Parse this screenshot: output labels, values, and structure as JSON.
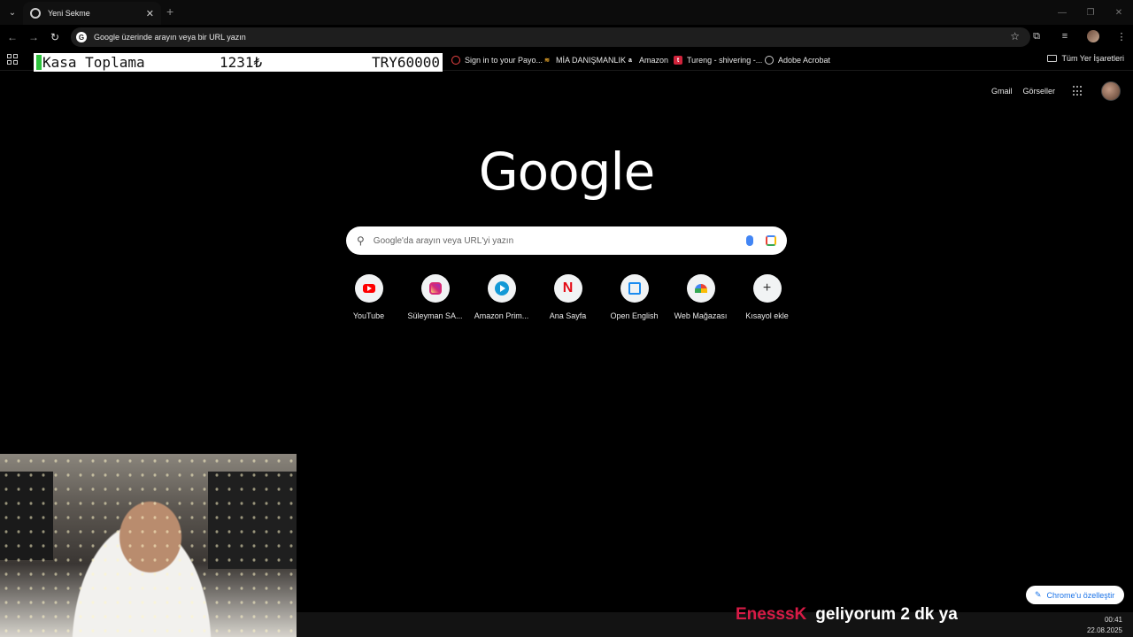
{
  "browser": {
    "tab": {
      "title": "Yeni Sekme"
    },
    "omnibox": {
      "text": "Google üzerinde arayın veya bir URL yazın"
    },
    "bookmarks": [
      {
        "label": "Sign in to your Payo...",
        "icon": "payoneer-icon"
      },
      {
        "label": "MİA DANIŞMANLIK",
        "icon": "mia-icon"
      },
      {
        "label": "Amazon",
        "icon": "amazon-icon"
      },
      {
        "label": "Tureng - shivering -...",
        "icon": "tureng-icon"
      },
      {
        "label": "Adobe Acrobat",
        "icon": "acrobat-icon"
      }
    ],
    "all_bookmarks": "Tüm Yer İşaretleri"
  },
  "overlay": {
    "title": "Kasa Toplama",
    "current": "1231₺",
    "goal": "TRY60000"
  },
  "page": {
    "gmail": "Gmail",
    "images": "Görseller",
    "logo": "Google",
    "search_placeholder": "Google'da arayın veya URL'yi yazın",
    "shortcuts": [
      {
        "label": "YouTube",
        "icon": "youtube-icon"
      },
      {
        "label": "Süleyman SA...",
        "icon": "instagram-icon"
      },
      {
        "label": "Amazon Prim...",
        "icon": "prime-video-icon"
      },
      {
        "label": "Ana Sayfa",
        "icon": "netflix-icon"
      },
      {
        "label": "Open English",
        "icon": "open-english-icon"
      },
      {
        "label": "Web Mağazası",
        "icon": "web-store-icon"
      },
      {
        "label": "Kısayol ekle",
        "icon": "plus-icon"
      }
    ],
    "customize": "Chrome'u özelleştir"
  },
  "stream": {
    "chat_user": "EnesssK",
    "chat_message": "geliyorum 2 dk ya",
    "time": "00:41",
    "date": "22.08.2025"
  },
  "colors": {
    "chat_user": "#d81b46",
    "overlay_marker": "#2ec43d",
    "link_blue": "#1a73e8"
  }
}
